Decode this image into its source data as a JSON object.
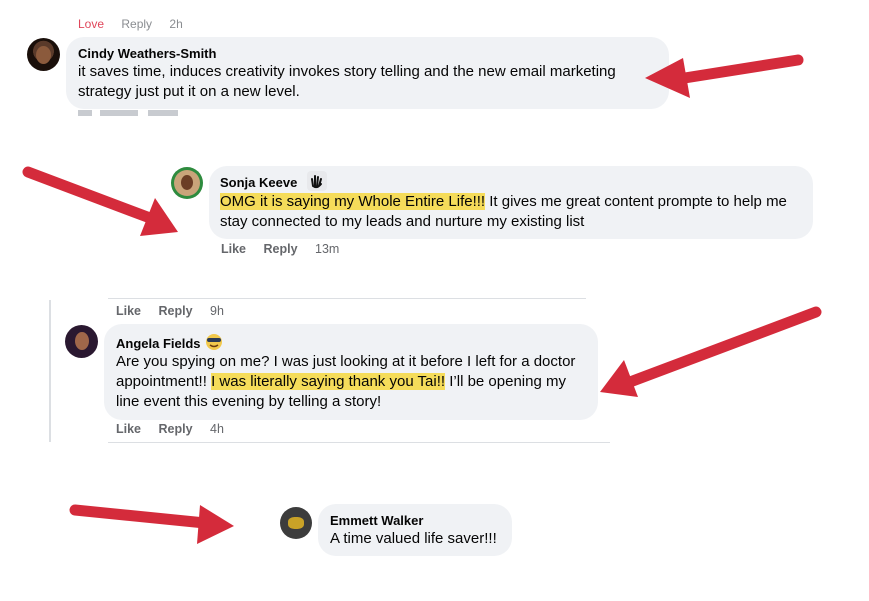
{
  "fragment_top": {
    "left": "Love",
    "middle": "Reply",
    "right": "2h"
  },
  "comments": [
    {
      "name": "Cindy Weathers-Smith",
      "text": "it saves time, induces creativity invokes story telling and the new email marketing strategy just put it on a new level."
    },
    {
      "name": "Sonja Keeve",
      "badge_icon": "wave-hand-icon",
      "highlight": "OMG it is saying my Whole Entire Life!!!",
      "text_rest": " It gives me great content prompte to help me stay connected to my leads and nurture my existing list",
      "like": "Like",
      "reply": "Reply",
      "time": "13m"
    },
    {
      "name": "Angela Fields",
      "badge_icon": "emoji-badge-icon",
      "prev_like": "Like",
      "prev_reply": "Reply",
      "prev_time": "9h",
      "text_before": "Are you spying on me? I was just looking at it before I left for a doctor appointment!! ",
      "highlight": "I was literally saying thank you Tai!!",
      "text_after": " I’ll be opening my line event this evening by telling a story!",
      "like": "Like",
      "reply": "Reply",
      "time": "4h"
    },
    {
      "name": "Emmett Walker",
      "text": "A time valued life saver!!!"
    }
  ],
  "colors": {
    "arrow": "#d42b3b",
    "highlight": "#f5dc5a",
    "bubble": "#f0f2f5",
    "meta": "#65676b"
  }
}
